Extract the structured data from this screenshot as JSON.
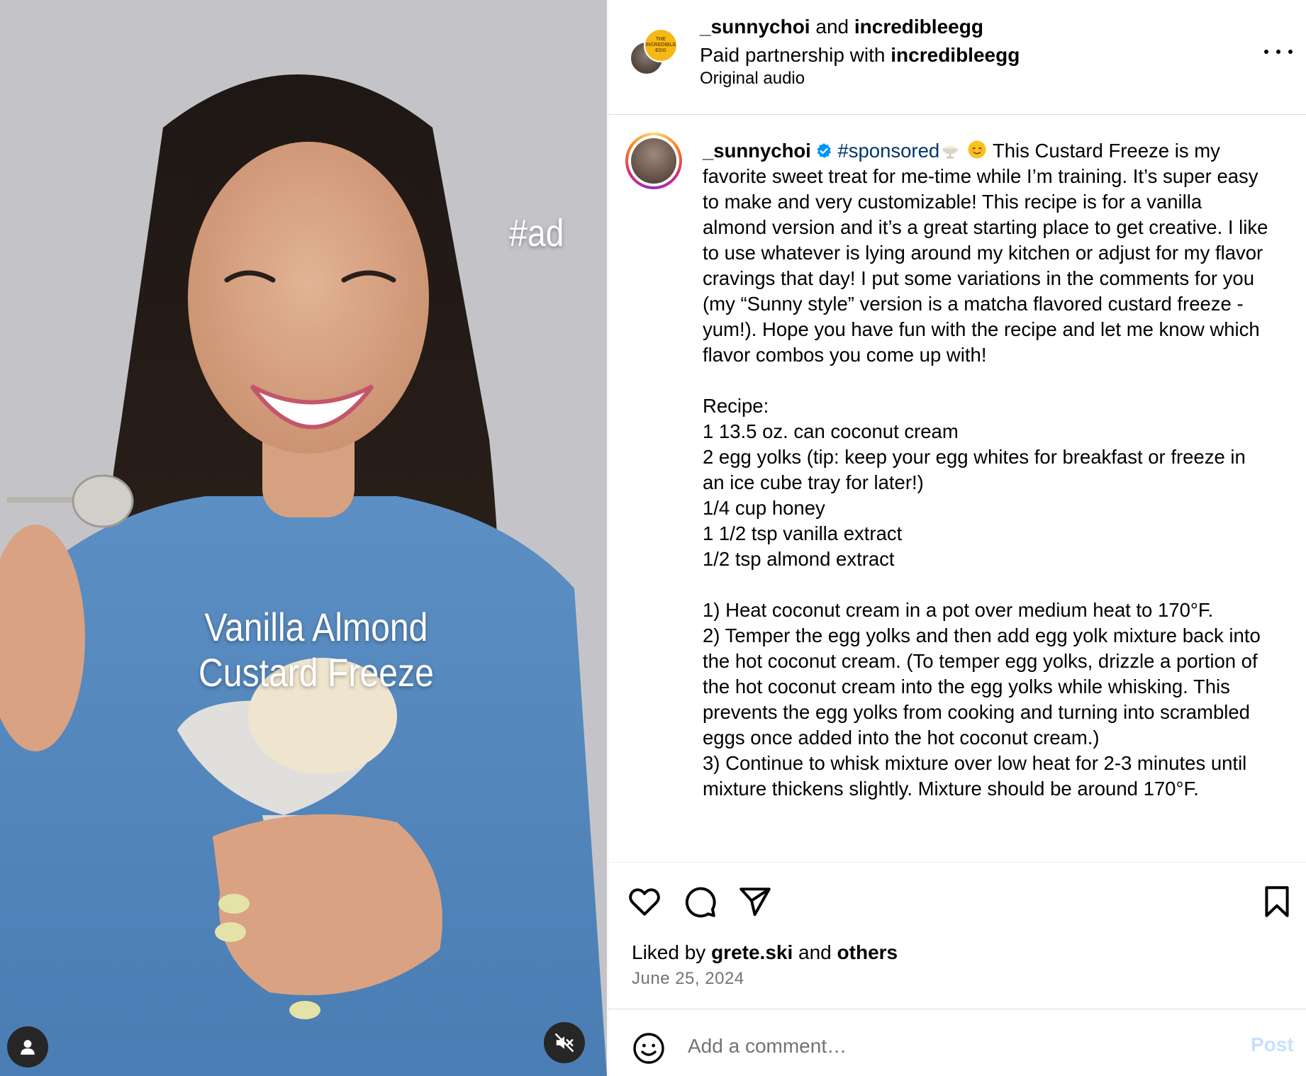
{
  "media": {
    "ad_tag": "#ad",
    "title_line1": "Vanilla Almond",
    "title_line2": "Custard Freeze"
  },
  "header": {
    "account1": "_sunnychoi",
    "joiner": " and ",
    "account2": "incredibleegg",
    "partnership_prefix": "Paid partnership with ",
    "partner": "incredibleegg",
    "audio": "Original audio",
    "egg_logo_text": "THE INCREDIBLE EGG"
  },
  "caption": {
    "username": "_sunnychoi",
    "hashtag": "#sponsored",
    "text": " This Custard Freeze is my favorite sweet treat for me-time while I’m training. It’s super easy to make and very customizable! This recipe is for a vanilla almond version and it’s a great starting place to get creative. I like to use whatever is lying around my kitchen or adjust for my flavor cravings that day! I put some variations in the comments for you (my “Sunny style” version is a matcha flavored custard freeze - yum!). Hope you have fun with the recipe and let me know which flavor combos you come up with!\n\nRecipe:\n1 13.5 oz. can coconut cream\n2 egg yolks (tip: keep your egg whites for breakfast or freeze in an ice cube tray for later!)\n1/4 cup honey\n1 1/2 tsp vanilla extract\n1/2 tsp almond extract\n\n1) Heat coconut cream in a pot over medium heat to 170°F.\n2) Temper the egg yolks and then add egg yolk mixture back into the hot coconut cream. (To temper egg yolks, drizzle a portion of the hot coconut cream into the egg yolks while whisking. This prevents the egg yolks from cooking and turning into scrambled eggs once added into the hot coconut cream.)\n3) Continue to whisk mixture over low heat for 2-3 minutes until mixture thickens slightly. Mixture should be around 170°F."
  },
  "engagement": {
    "liked_prefix": "Liked by ",
    "liked_user": "grete.ski",
    "liked_mid": " and ",
    "liked_others": "others",
    "date": "June 25, 2024"
  },
  "comment": {
    "placeholder": "Add a comment…",
    "post_label": "Post"
  },
  "colors": {
    "link": "#00376b",
    "verified": "#0095f6",
    "post_disabled": "#c7e0fd",
    "secondary_text": "#737373"
  },
  "icons": [
    "user-tag-icon",
    "mute-icon",
    "more-icon",
    "verified-icon",
    "heart-icon",
    "comment-icon",
    "share-icon",
    "bookmark-icon",
    "emoji-icon"
  ]
}
